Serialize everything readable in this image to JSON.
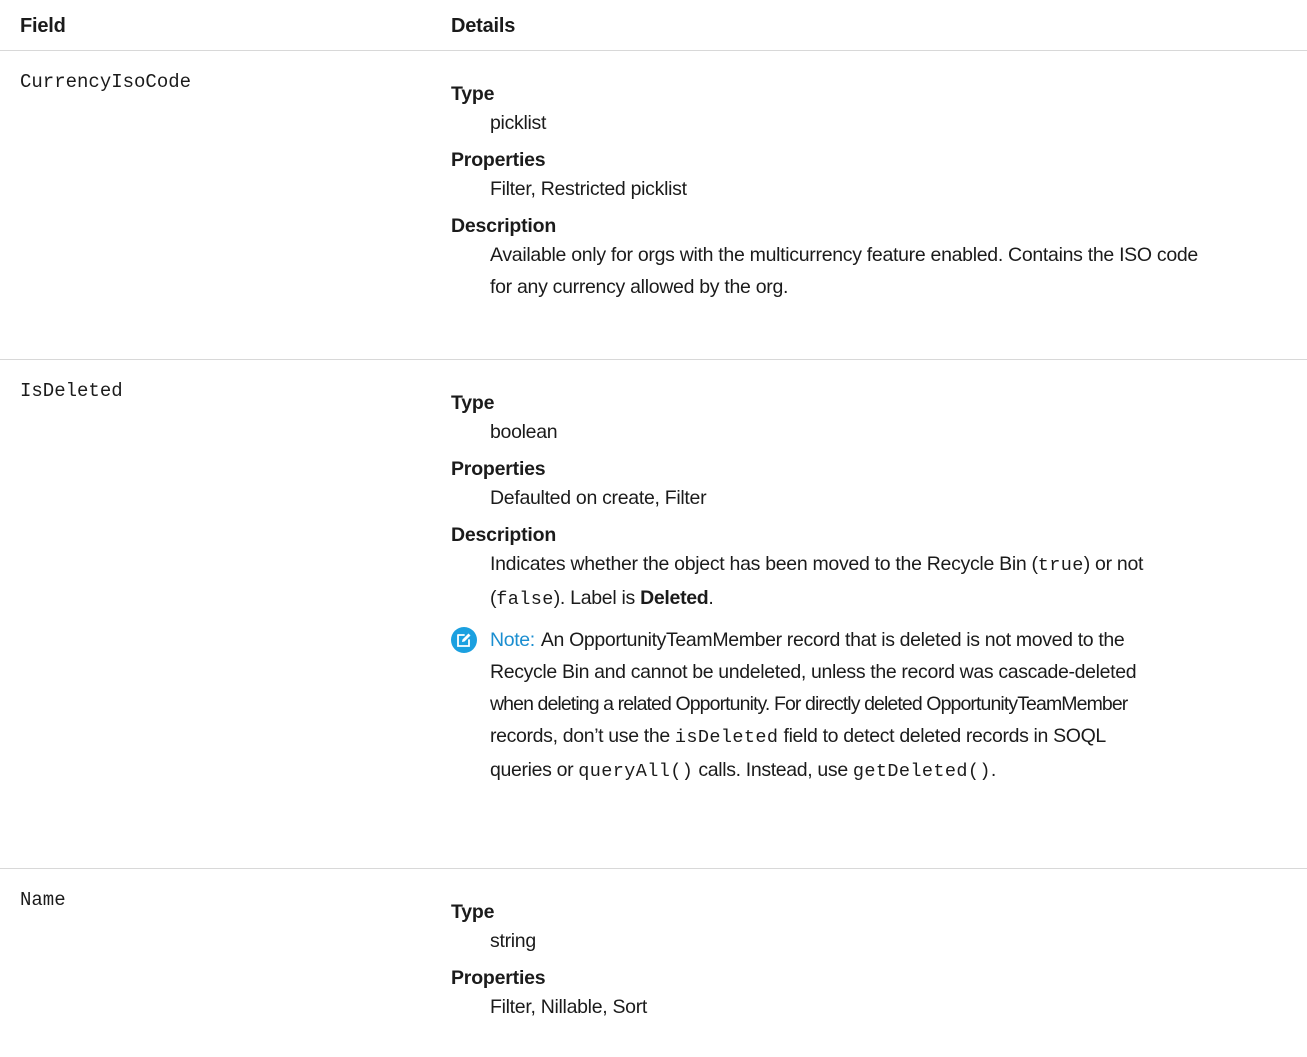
{
  "header": {
    "field": "Field",
    "details": "Details"
  },
  "rows": [
    {
      "name": "CurrencyIsoCode",
      "type_label": "Type",
      "type": "picklist",
      "properties_label": "Properties",
      "properties": "Filter, Restricted picklist",
      "description_label": "Description",
      "description_line1": "Available only for orgs with the multicurrency feature enabled. Contains the ISO code",
      "description_line2": "for any currency allowed by the org."
    },
    {
      "name": "IsDeleted",
      "type_label": "Type",
      "type": "boolean",
      "properties_label": "Properties",
      "properties": "Defaulted on create, Filter",
      "description_label": "Description",
      "desc_part1": "Indicates whether the object has been moved to the Recycle Bin (",
      "desc_code1": "true",
      "desc_part2": ") or not",
      "desc_code2": "false",
      "desc_part3": "). Label is ",
      "desc_bold": "Deleted",
      "desc_part4": ".",
      "note_label": "Note:",
      "note_line1": "An OpportunityTeamMember record that is deleted is not moved to the",
      "note_line2": "Recycle Bin and cannot be undeleted, unless the record was cascade-deleted",
      "note_line3": "when deleting a related Opportunity. For directly deleted OpportunityTeamMember",
      "note_part4a": "records, don’t use the ",
      "note_code1": "isDeleted",
      "note_part4b": " field to detect deleted records in SOQL",
      "note_part5a": "queries or ",
      "note_code2": "queryAll()",
      "note_part5b": " calls. Instead, use ",
      "note_code3": "getDeleted()",
      "note_part5c": "."
    },
    {
      "name": "Name",
      "type_label": "Type",
      "type": "string",
      "properties_label": "Properties",
      "properties": "Filter, Nillable, Sort"
    }
  ],
  "icons": {
    "note": "note-edit-icon"
  },
  "colors": {
    "note_accent": "#1b8ed0",
    "divider": "#d8d8d8"
  }
}
